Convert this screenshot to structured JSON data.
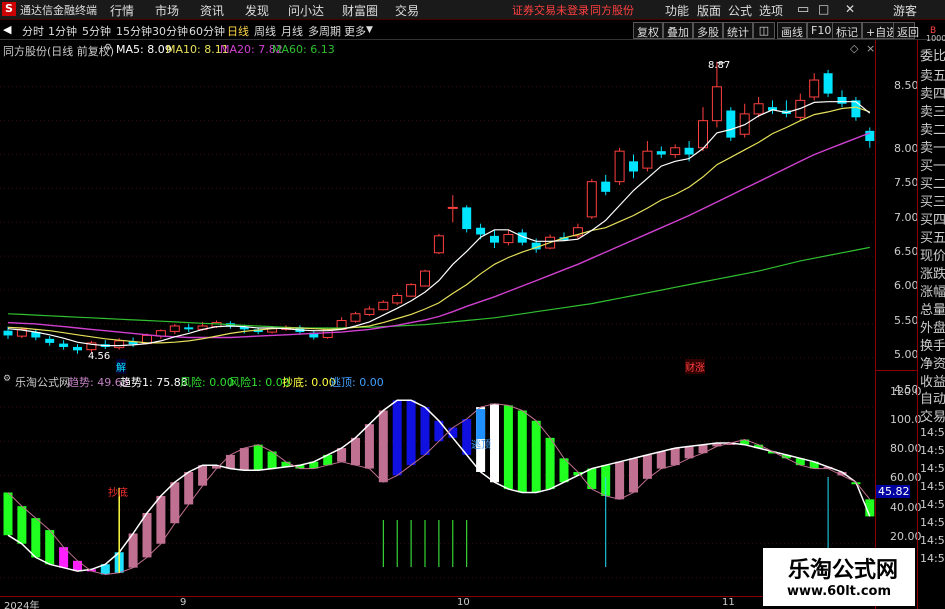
{
  "menubar": {
    "logo": "S",
    "app_title": "通达信金融终端",
    "items": [
      "行情",
      "市场",
      "资讯",
      "发现",
      "问小达",
      "财富圈",
      "交易"
    ],
    "notice": "证券交易未登录",
    "stock": "同方股份",
    "right": [
      "功能",
      "版面",
      "公式",
      "选项"
    ],
    "guest": "游客"
  },
  "timeframes": [
    "分时",
    "1分钟",
    "5分钟",
    "15分钟",
    "30分钟",
    "60分钟",
    "日线",
    "周线",
    "月线",
    "多周期",
    "更多"
  ],
  "active_tf": "日线",
  "toolbar_right": [
    "复权",
    "叠加",
    "多股",
    "统计",
    "画线",
    "F10",
    "标记",
    "+自选",
    "返回"
  ],
  "info": {
    "title": "同方股份(日线 前复权)",
    "ma5": "MA5: 8.09",
    "ma10": "MA10: 8.11",
    "ma20": "MA20: 7.82",
    "ma60": "MA60: 6.13"
  },
  "ind_info": {
    "name": "乐淘公式网",
    "trend": "趋势: 49.63",
    "trend1": "趋势1: 75.88",
    "risk": "风险: 0.00",
    "risk1": "风险1: 0.00",
    "bottom": "抄底: 0.00",
    "escape": "逃顶: 0.00"
  },
  "y_main": [
    "8.50",
    "8.00",
    "7.50",
    "7.00",
    "6.50",
    "6.00",
    "5.50",
    "5.00",
    "4.50"
  ],
  "y_ind": [
    "120.0",
    "100.0",
    "80.00",
    "60.00",
    "40.00",
    "20.00"
  ],
  "ind_value": "45.82",
  "right_panel": [
    "委比",
    "卖五",
    "卖四",
    "卖三",
    "卖二",
    "卖一",
    "买一",
    "买二",
    "买三",
    "买四",
    "买五",
    "现价",
    "涨跌",
    "涨幅",
    "总量",
    "外盘",
    "换手",
    "净资",
    "收益",
    "自动",
    "交易"
  ],
  "right_times": [
    "14:56",
    "14:56",
    "14:56",
    "14:56",
    "14:56",
    "14:56",
    "14:56",
    "14:56"
  ],
  "right_top": [
    "B",
    "1000"
  ],
  "x_labels": [
    "2024年",
    "9",
    "10",
    "11"
  ],
  "annotations": {
    "high": "8.87",
    "low": "4.56",
    "jie": "解",
    "caizhang": "财涨",
    "chaodi": "抄底",
    "taoding": "逃顶"
  },
  "watermark": {
    "name": "乐淘公式网",
    "url": "www.60lt.com"
  },
  "colors": {
    "up": "#ff4040",
    "down": "#00e5ff",
    "ma5": "#ffffff",
    "ma10": "#e6e05a",
    "ma20": "#d040d0",
    "ma60": "#30c030",
    "accent": "#ff2020"
  },
  "chart_data": {
    "type": "candlestick",
    "y_range": [
      4.32,
      8.94
    ],
    "candles": [
      {
        "o": 4.9,
        "c": 4.83,
        "h": 4.96,
        "l": 4.78
      },
      {
        "o": 4.82,
        "c": 4.92,
        "h": 4.95,
        "l": 4.79
      },
      {
        "o": 4.88,
        "c": 4.8,
        "h": 4.91,
        "l": 4.76
      },
      {
        "o": 4.78,
        "c": 4.72,
        "h": 4.82,
        "l": 4.68
      },
      {
        "o": 4.71,
        "c": 4.66,
        "h": 4.76,
        "l": 4.62
      },
      {
        "o": 4.66,
        "c": 4.61,
        "h": 4.7,
        "l": 4.56
      },
      {
        "o": 4.62,
        "c": 4.72,
        "h": 4.75,
        "l": 4.58
      },
      {
        "o": 4.7,
        "c": 4.66,
        "h": 4.76,
        "l": 4.63
      },
      {
        "o": 4.65,
        "c": 4.75,
        "h": 4.79,
        "l": 4.62
      },
      {
        "o": 4.74,
        "c": 4.7,
        "h": 4.8,
        "l": 4.66
      },
      {
        "o": 4.71,
        "c": 4.83,
        "h": 4.86,
        "l": 4.7
      },
      {
        "o": 4.82,
        "c": 4.9,
        "h": 4.92,
        "l": 4.78
      },
      {
        "o": 4.89,
        "c": 4.97,
        "h": 5.0,
        "l": 4.85
      },
      {
        "o": 4.95,
        "c": 4.92,
        "h": 5.0,
        "l": 4.88
      },
      {
        "o": 4.92,
        "c": 4.97,
        "h": 5.03,
        "l": 4.9
      },
      {
        "o": 4.96,
        "c": 5.02,
        "h": 5.05,
        "l": 4.94
      },
      {
        "o": 5.01,
        "c": 4.96,
        "h": 5.04,
        "l": 4.93
      },
      {
        "o": 4.96,
        "c": 4.92,
        "h": 4.99,
        "l": 4.86
      },
      {
        "o": 4.92,
        "c": 4.88,
        "h": 4.95,
        "l": 4.85
      },
      {
        "o": 4.88,
        "c": 4.93,
        "h": 4.96,
        "l": 4.86
      },
      {
        "o": 4.92,
        "c": 4.95,
        "h": 4.98,
        "l": 4.9
      },
      {
        "o": 4.95,
        "c": 4.88,
        "h": 4.98,
        "l": 4.84
      },
      {
        "o": 4.87,
        "c": 4.8,
        "h": 4.91,
        "l": 4.77
      },
      {
        "o": 4.8,
        "c": 4.92,
        "h": 4.95,
        "l": 4.78
      },
      {
        "o": 4.92,
        "c": 5.05,
        "h": 5.1,
        "l": 4.91
      },
      {
        "o": 5.04,
        "c": 5.15,
        "h": 5.18,
        "l": 5.02
      },
      {
        "o": 5.14,
        "c": 5.22,
        "h": 5.26,
        "l": 5.12
      },
      {
        "o": 5.21,
        "c": 5.32,
        "h": 5.35,
        "l": 5.2
      },
      {
        "o": 5.31,
        "c": 5.42,
        "h": 5.46,
        "l": 5.28
      },
      {
        "o": 5.41,
        "c": 5.58,
        "h": 5.6,
        "l": 5.4
      },
      {
        "o": 5.56,
        "c": 5.78,
        "h": 5.8,
        "l": 5.55
      },
      {
        "o": 6.05,
        "c": 6.3,
        "h": 6.33,
        "l": 6.03
      },
      {
        "o": 6.72,
        "c": 6.72,
        "h": 6.9,
        "l": 6.5
      },
      {
        "o": 6.72,
        "c": 6.4,
        "h": 6.75,
        "l": 6.35
      },
      {
        "o": 6.42,
        "c": 6.32,
        "h": 6.48,
        "l": 6.25
      },
      {
        "o": 6.3,
        "c": 6.2,
        "h": 6.38,
        "l": 6.12
      },
      {
        "o": 6.2,
        "c": 6.32,
        "h": 6.38,
        "l": 6.16
      },
      {
        "o": 6.35,
        "c": 6.2,
        "h": 6.4,
        "l": 6.16
      },
      {
        "o": 6.2,
        "c": 6.1,
        "h": 6.26,
        "l": 6.05
      },
      {
        "o": 6.12,
        "c": 6.28,
        "h": 6.32,
        "l": 6.1
      },
      {
        "o": 6.28,
        "c": 6.24,
        "h": 6.35,
        "l": 6.22
      },
      {
        "o": 6.3,
        "c": 6.42,
        "h": 6.48,
        "l": 6.25
      },
      {
        "o": 6.58,
        "c": 7.1,
        "h": 7.14,
        "l": 6.55
      },
      {
        "o": 7.1,
        "c": 6.95,
        "h": 7.2,
        "l": 6.9
      },
      {
        "o": 7.1,
        "c": 7.55,
        "h": 7.6,
        "l": 7.05
      },
      {
        "o": 7.4,
        "c": 7.25,
        "h": 7.5,
        "l": 7.15
      },
      {
        "o": 7.3,
        "c": 7.55,
        "h": 7.7,
        "l": 7.25
      },
      {
        "o": 7.55,
        "c": 7.5,
        "h": 7.62,
        "l": 7.45
      },
      {
        "o": 7.5,
        "c": 7.6,
        "h": 7.65,
        "l": 7.45
      },
      {
        "o": 7.6,
        "c": 7.5,
        "h": 7.7,
        "l": 7.4
      },
      {
        "o": 7.6,
        "c": 8.0,
        "h": 8.2,
        "l": 7.55
      },
      {
        "o": 8.0,
        "c": 8.5,
        "h": 8.87,
        "l": 7.9
      },
      {
        "o": 8.15,
        "c": 7.75,
        "h": 8.2,
        "l": 7.7
      },
      {
        "o": 7.8,
        "c": 8.1,
        "h": 8.25,
        "l": 7.75
      },
      {
        "o": 8.1,
        "c": 8.25,
        "h": 8.35,
        "l": 8.05
      },
      {
        "o": 8.2,
        "c": 8.15,
        "h": 8.3,
        "l": 8.1
      },
      {
        "o": 8.15,
        "c": 8.1,
        "h": 8.3,
        "l": 8.05
      },
      {
        "o": 8.05,
        "c": 8.3,
        "h": 8.4,
        "l": 8.0
      },
      {
        "o": 8.35,
        "c": 8.6,
        "h": 8.7,
        "l": 8.3
      },
      {
        "o": 8.7,
        "c": 8.4,
        "h": 8.75,
        "l": 8.35
      },
      {
        "o": 8.35,
        "c": 8.25,
        "h": 8.45,
        "l": 8.2
      },
      {
        "o": 8.3,
        "c": 8.05,
        "h": 8.35,
        "l": 8.0
      },
      {
        "o": 7.85,
        "c": 7.7,
        "h": 7.9,
        "l": 7.6
      }
    ],
    "ma5": [
      4.93,
      4.91,
      4.88,
      4.84,
      4.79,
      4.73,
      4.7,
      4.68,
      4.68,
      4.69,
      4.71,
      4.75,
      4.81,
      4.86,
      4.92,
      4.96,
      4.97,
      4.96,
      4.94,
      4.94,
      4.93,
      4.91,
      4.9,
      4.9,
      4.92,
      4.97,
      5.03,
      5.13,
      5.23,
      5.34,
      5.47,
      5.64,
      5.88,
      6.07,
      6.28,
      6.39,
      6.39,
      6.29,
      6.22,
      6.22,
      6.23,
      6.25,
      6.38,
      6.53,
      6.75,
      6.97,
      7.15,
      7.33,
      7.4,
      7.44,
      7.59,
      7.82,
      7.87,
      7.94,
      8.07,
      8.16,
      8.12,
      8.18,
      8.27,
      8.28,
      8.28,
      8.28,
      8.11
    ],
    "ma10": [
      4.95,
      4.94,
      4.92,
      4.9,
      4.87,
      4.84,
      4.81,
      4.78,
      4.76,
      4.74,
      4.72,
      4.72,
      4.73,
      4.75,
      4.78,
      4.82,
      4.86,
      4.89,
      4.91,
      4.93,
      4.94,
      4.94,
      4.93,
      4.92,
      4.93,
      4.95,
      4.97,
      5.02,
      5.08,
      5.14,
      5.22,
      5.31,
      5.45,
      5.58,
      5.74,
      5.88,
      5.98,
      6.06,
      6.13,
      6.2,
      6.27,
      6.32,
      6.38,
      6.42,
      6.51,
      6.6,
      6.71,
      6.83,
      6.91,
      7.02,
      7.17,
      7.35,
      7.46,
      7.57,
      7.68,
      7.81,
      7.9,
      8.0,
      8.09,
      8.13,
      8.18,
      8.2,
      8.13
    ],
    "ma20": [
      5.02,
      5.01,
      5.0,
      4.98,
      4.96,
      4.94,
      4.92,
      4.9,
      4.88,
      4.86,
      4.84,
      4.82,
      4.81,
      4.8,
      4.8,
      4.8,
      4.8,
      4.81,
      4.82,
      4.83,
      4.84,
      4.85,
      4.86,
      4.87,
      4.88,
      4.9,
      4.92,
      4.95,
      4.98,
      5.02,
      5.06,
      5.11,
      5.18,
      5.26,
      5.33,
      5.4,
      5.48,
      5.56,
      5.64,
      5.72,
      5.8,
      5.88,
      5.97,
      6.06,
      6.15,
      6.24,
      6.33,
      6.42,
      6.51,
      6.6,
      6.7,
      6.8,
      6.9,
      7.0,
      7.1,
      7.2,
      7.3,
      7.4,
      7.5,
      7.58,
      7.66,
      7.74,
      7.82
    ],
    "ma60": [
      5.15,
      5.14,
      5.13,
      5.12,
      5.11,
      5.1,
      5.09,
      5.08,
      5.07,
      5.06,
      5.05,
      5.04,
      5.03,
      5.02,
      5.01,
      5.0,
      4.99,
      4.98,
      4.97,
      4.96,
      4.95,
      4.94,
      4.94,
      4.94,
      4.94,
      4.95,
      4.95,
      4.96,
      4.97,
      4.98,
      4.99,
      5.01,
      5.03,
      5.05,
      5.07,
      5.09,
      5.12,
      5.15,
      5.18,
      5.21,
      5.24,
      5.27,
      5.3,
      5.34,
      5.38,
      5.42,
      5.46,
      5.5,
      5.54,
      5.58,
      5.62,
      5.66,
      5.7,
      5.74,
      5.78,
      5.83,
      5.88,
      5.93,
      5.97,
      6.01,
      6.05,
      6.09,
      6.13
    ],
    "ind_range": [
      10,
      130
    ],
    "trend": [
      70,
      62,
      55,
      48,
      38,
      30,
      24,
      22,
      23,
      26,
      32,
      40,
      52,
      63,
      74,
      84,
      92,
      96,
      98,
      94,
      88,
      84,
      84,
      86,
      88,
      86,
      84,
      76,
      80,
      86,
      92,
      100,
      108,
      113,
      120,
      122,
      121,
      118,
      112,
      102,
      90,
      82,
      72,
      68,
      66,
      70,
      78,
      84,
      86,
      90,
      93,
      97,
      99,
      101,
      98,
      94,
      90,
      86,
      84,
      84,
      80,
      76,
      66
    ],
    "trend1": [
      45,
      40,
      32,
      28,
      26,
      24,
      25,
      28,
      35,
      46,
      58,
      68,
      76,
      82,
      86,
      86,
      84,
      83,
      83,
      84,
      85,
      86,
      88,
      92,
      96,
      102,
      110,
      118,
      124,
      124,
      120,
      112,
      102,
      92,
      82,
      76,
      72,
      70,
      70,
      72,
      76,
      80,
      84,
      86,
      88,
      90,
      92,
      94,
      96,
      97,
      98,
      99,
      99,
      98,
      96,
      94,
      92,
      90,
      88,
      85,
      82,
      76,
      56
    ],
    "trend_colors": [
      "g",
      "g",
      "g",
      "g",
      "m",
      "m",
      "m",
      "c",
      "c",
      "p",
      "p",
      "p",
      "p",
      "p",
      "p",
      "p",
      "p",
      "p",
      "g",
      "g",
      "g",
      "g",
      "g",
      "g",
      "p",
      "p",
      "p",
      "p",
      "b",
      "b",
      "b",
      "b",
      "b",
      "b",
      "w",
      "w",
      "g",
      "g",
      "g",
      "g",
      "g",
      "g",
      "g",
      "g",
      "p",
      "p",
      "p",
      "p",
      "p",
      "p",
      "p",
      "p",
      "p",
      "g",
      "g",
      "g",
      "g",
      "g",
      "g",
      "p",
      "p",
      "g",
      "g"
    ],
    "escape_bar": 34,
    "bottom_bar": 8,
    "green_spikes": [
      27,
      28,
      29,
      30,
      31,
      32,
      33
    ],
    "cyan_spikes": [
      43,
      59
    ]
  }
}
